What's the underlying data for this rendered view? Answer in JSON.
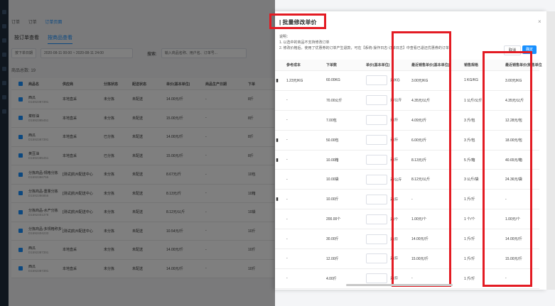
{
  "background": {
    "breadcrumb": [
      "订单",
      "订单",
      "订单页面"
    ],
    "tabs": [
      "按订单查看",
      "按商品查看"
    ],
    "filters": [
      "按下单日期",
      "2020-08-11 00:00 ~ 2020-08-11 24:00",
      "搜索:",
      "输入商品名称、用户名、订单号..."
    ],
    "total": "商品总数: 19",
    "columns": [
      "商品名",
      "供应商",
      "分拣状态",
      "配送状态",
      "单价(基本单位)",
      "商品生产日期",
      "下单"
    ],
    "rows": [
      {
        "name": "西瓜",
        "sub": "D1592387391",
        "supplier": "本地直采",
        "status": "未分拣",
        "ship": "未配送",
        "price": "14.00元/斤",
        "date": "-",
        "qty": "8斤"
      },
      {
        "name": "菜籽油",
        "sub": "D1592385451",
        "supplier": "本地直采",
        "status": "未分拣",
        "ship": "未配送",
        "price": "15.00元/斤",
        "date": "-",
        "qty": "8斤"
      },
      {
        "name": "西瓜",
        "sub": "D1592387391",
        "supplier": "本地直采",
        "status": "已分拣",
        "ship": "未配送",
        "price": "14.00元/斤",
        "date": "-",
        "qty": "8斤"
      },
      {
        "name": "黄豆油",
        "sub": "D1592385451",
        "supplier": "本地直采",
        "status": "已分拣",
        "ship": "未配送",
        "price": "15.00元/斤",
        "date": "-",
        "qty": "8斤"
      },
      {
        "name": "分拣商品-规格分拣",
        "sub": "D1592386755",
        "supplier": "[测试]杭州配送中心",
        "status": "未分拣",
        "ship": "未配送",
        "price": "8.67元/斤",
        "date": "-",
        "qty": "10包"
      },
      {
        "name": "分拣商品-重量分拣",
        "sub": "D1592386856",
        "supplier": "[测试]杭州配送中心",
        "status": "未分拣",
        "ship": "未配送",
        "price": "8.13元/斤",
        "date": "-",
        "qty": "10箱"
      },
      {
        "name": "分拣商品-水产分拣",
        "sub": "D1592401378",
        "supplier": "[测试]杭州配送中心",
        "status": "未分拣",
        "ship": "未配送",
        "price": "8.12元/公斤",
        "date": "-",
        "qty": "10袋"
      },
      {
        "name": "分拣商品-多规格称多个",
        "sub": "D1592404233",
        "supplier": "[测试]杭州配送中心",
        "status": "未分拣",
        "ship": "未配送",
        "price": "10.54元/斤",
        "date": "-",
        "qty": "10斤"
      },
      {
        "name": "西瓜",
        "sub": "D1592387391",
        "supplier": "本地直采",
        "status": "未分拣",
        "ship": "未配送",
        "price": "14.00元/斤",
        "date": "-",
        "qty": "10斤"
      },
      {
        "name": "西瓜",
        "sub": "D1592387391",
        "supplier": "本地直采",
        "status": "未分拣",
        "ship": "未配送",
        "price": "14.00元/斤",
        "date": "-",
        "qty": "10斤"
      }
    ]
  },
  "modal": {
    "title": "| 批量修改单价",
    "close": "×",
    "notes_title": "说明：",
    "note1": "1. 以选中的商品不支持修改订单",
    "note2": "2. 修改价格后，使用了优惠券的订单产生退款，可在【系统-操作日志-订单日志】中查看已退还优惠券的订单",
    "cancel": "取消",
    "confirm": "确定",
    "columns": [
      "参考成本",
      "下单数",
      "单价(基本单位)",
      "最近销售单价(基本单位)",
      "销售规格",
      "最近销售单价(销售单位"
    ],
    "rows": [
      {
        "mark": "▮",
        "cost": "1.23元/KG",
        "qty": "60.00KG",
        "unit": "元/KG",
        "recent": "3.00元/KG",
        "spec": "1 KG/KG",
        "recent_sale": "3.00元/KG"
      },
      {
        "mark": "",
        "cost": "-",
        "qty": "70.00公斤",
        "unit": "元/公斤",
        "recent": "4.35元/公斤",
        "spec": "1 公斤/公斤",
        "recent_sale": "4.35元/公斤"
      },
      {
        "mark": "",
        "cost": "-",
        "qty": "7.00包",
        "unit": "元/斤",
        "recent": "4.09元/斤",
        "spec": "3 斤/包",
        "recent_sale": "12.28元/包"
      },
      {
        "mark": "▮",
        "cost": "-",
        "qty": "50.00包",
        "unit": "元/斤",
        "recent": "6.00元/斤",
        "spec": "3 斤/包",
        "recent_sale": "18.00元/包"
      },
      {
        "mark": "▮",
        "cost": "-",
        "qty": "10.00箱",
        "unit": "元/斤",
        "recent": "8.13元/斤",
        "spec": "5 斤/箱",
        "recent_sale": "40.65元/箱"
      },
      {
        "mark": "",
        "cost": "-",
        "qty": "10.00袋",
        "unit": "元/公斤",
        "recent": "8.12元/公斤",
        "spec": "3 公斤/袋",
        "recent_sale": "24.36元/袋"
      },
      {
        "mark": "▮",
        "cost": "-",
        "qty": "10.00斤",
        "unit": "元/斤",
        "recent": "-",
        "spec": "1 斤/斤",
        "recent_sale": "-"
      },
      {
        "mark": "",
        "cost": "-",
        "qty": "200.00个",
        "unit": "元/个",
        "recent": "1.00元/个",
        "spec": "1 个/个",
        "recent_sale": "1.00元/个"
      },
      {
        "mark": "",
        "cost": "-",
        "qty": "30.00斤",
        "unit": "元/斤",
        "recent": "14.00元/斤",
        "spec": "1 斤/斤",
        "recent_sale": "14.00元/斤"
      },
      {
        "mark": "",
        "cost": "-",
        "qty": "12.00斤",
        "unit": "元/斤",
        "recent": "15.00元/斤",
        "spec": "1 斤/斤",
        "recent_sale": "15.00元/斤"
      },
      {
        "mark": "",
        "cost": "-",
        "qty": "4.00斤",
        "unit": "元/斤",
        "recent": "-",
        "spec": "1 斤/斤",
        "recent_sale": "-"
      }
    ]
  },
  "colors": {
    "highlight": "#e31b23",
    "primary": "#1890ff"
  }
}
